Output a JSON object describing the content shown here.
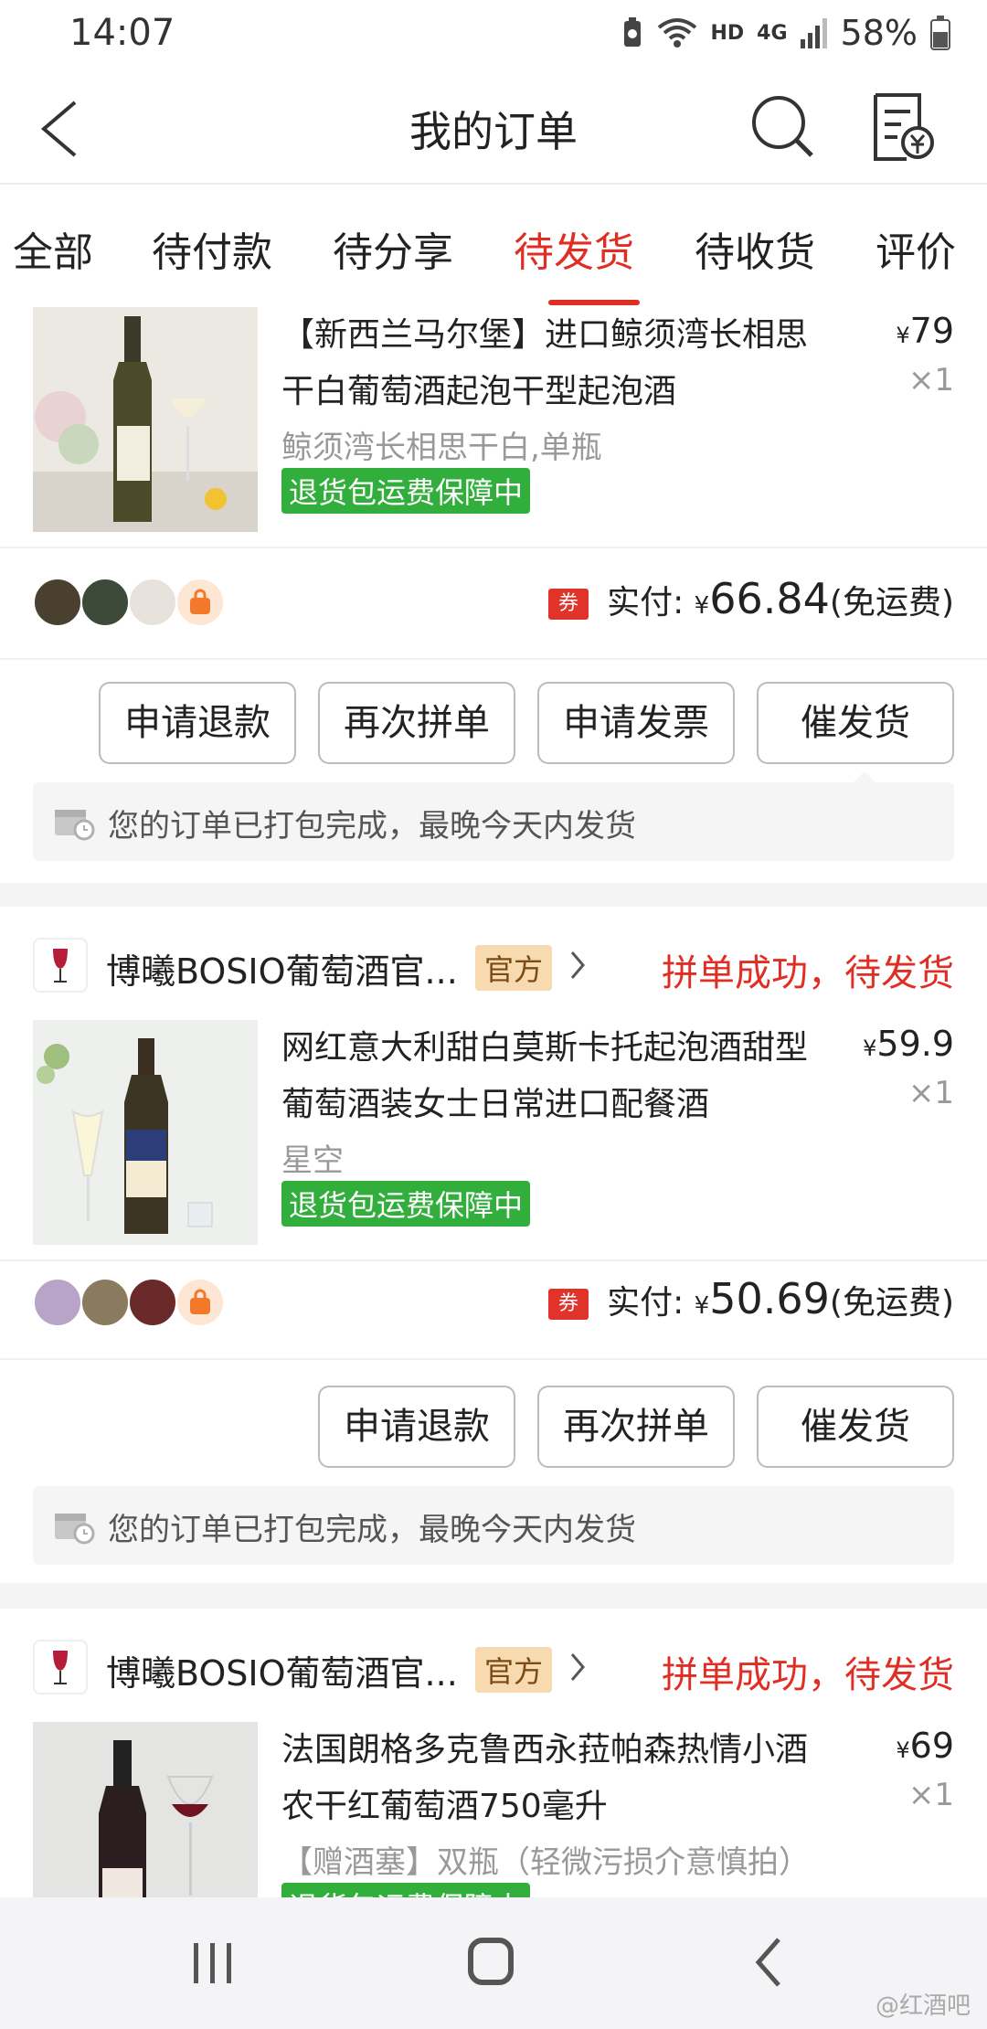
{
  "status_bar": {
    "time": "14:07",
    "network": "HD",
    "signal": "4G",
    "battery": "58%"
  },
  "header": {
    "title": "我的订单"
  },
  "tabs": [
    {
      "label": "全部"
    },
    {
      "label": "待付款"
    },
    {
      "label": "待分享"
    },
    {
      "label": "待发货",
      "active": true
    },
    {
      "label": "待收货"
    },
    {
      "label": "评价"
    }
  ],
  "orders": [
    {
      "product": {
        "title": "【新西兰马尔堡】进口鲸须湾长相思干白葡萄酒起泡干型起泡酒",
        "variant": "鲸须湾长相思干白,单瓶",
        "guarantee": "退货包运费保障中",
        "price_symbol": "¥",
        "price": "79",
        "qty": "×1"
      },
      "payment": {
        "label": "实付:",
        "symbol": "¥",
        "amount": "66.84",
        "shipping": "(免运费)",
        "coupon": "券"
      },
      "buttons": [
        "申请退款",
        "再次拼单",
        "申请发票",
        "催发货"
      ],
      "notice": "您的订单已打包完成，最晚今天内发货"
    },
    {
      "shop": {
        "name": "博曦BOSIO葡萄酒官...",
        "tag": "官方"
      },
      "status": "拼单成功，待发货",
      "product": {
        "title": "网红意大利甜白莫斯卡托起泡酒甜型葡萄酒装女士日常进口配餐酒",
        "variant": "星空",
        "guarantee": "退货包运费保障中",
        "price_symbol": "¥",
        "price": "59.9",
        "qty": "×1"
      },
      "payment": {
        "label": "实付:",
        "symbol": "¥",
        "amount": "50.69",
        "shipping": "(免运费)",
        "coupon": "券"
      },
      "buttons": [
        "申请退款",
        "再次拼单",
        "催发货"
      ],
      "notice": "您的订单已打包完成，最晚今天内发货"
    },
    {
      "shop": {
        "name": "博曦BOSIO葡萄酒官...",
        "tag": "官方"
      },
      "status": "拼单成功，待发货",
      "product": {
        "title": "法国朗格多克鲁西永菈帕森热情小酒农干红葡萄酒750毫升",
        "variant": "【赠酒塞】双瓶（轻微污损介意慎拍）",
        "guarantee": "退货包运费保障中",
        "price_symbol": "¥",
        "price": "69",
        "qty": "×1"
      }
    }
  ],
  "watermark": "@红酒吧",
  "colors": {
    "accent": "#e02e24",
    "guarantee": "#31ae3c",
    "official_tag": "#f8dab0"
  }
}
